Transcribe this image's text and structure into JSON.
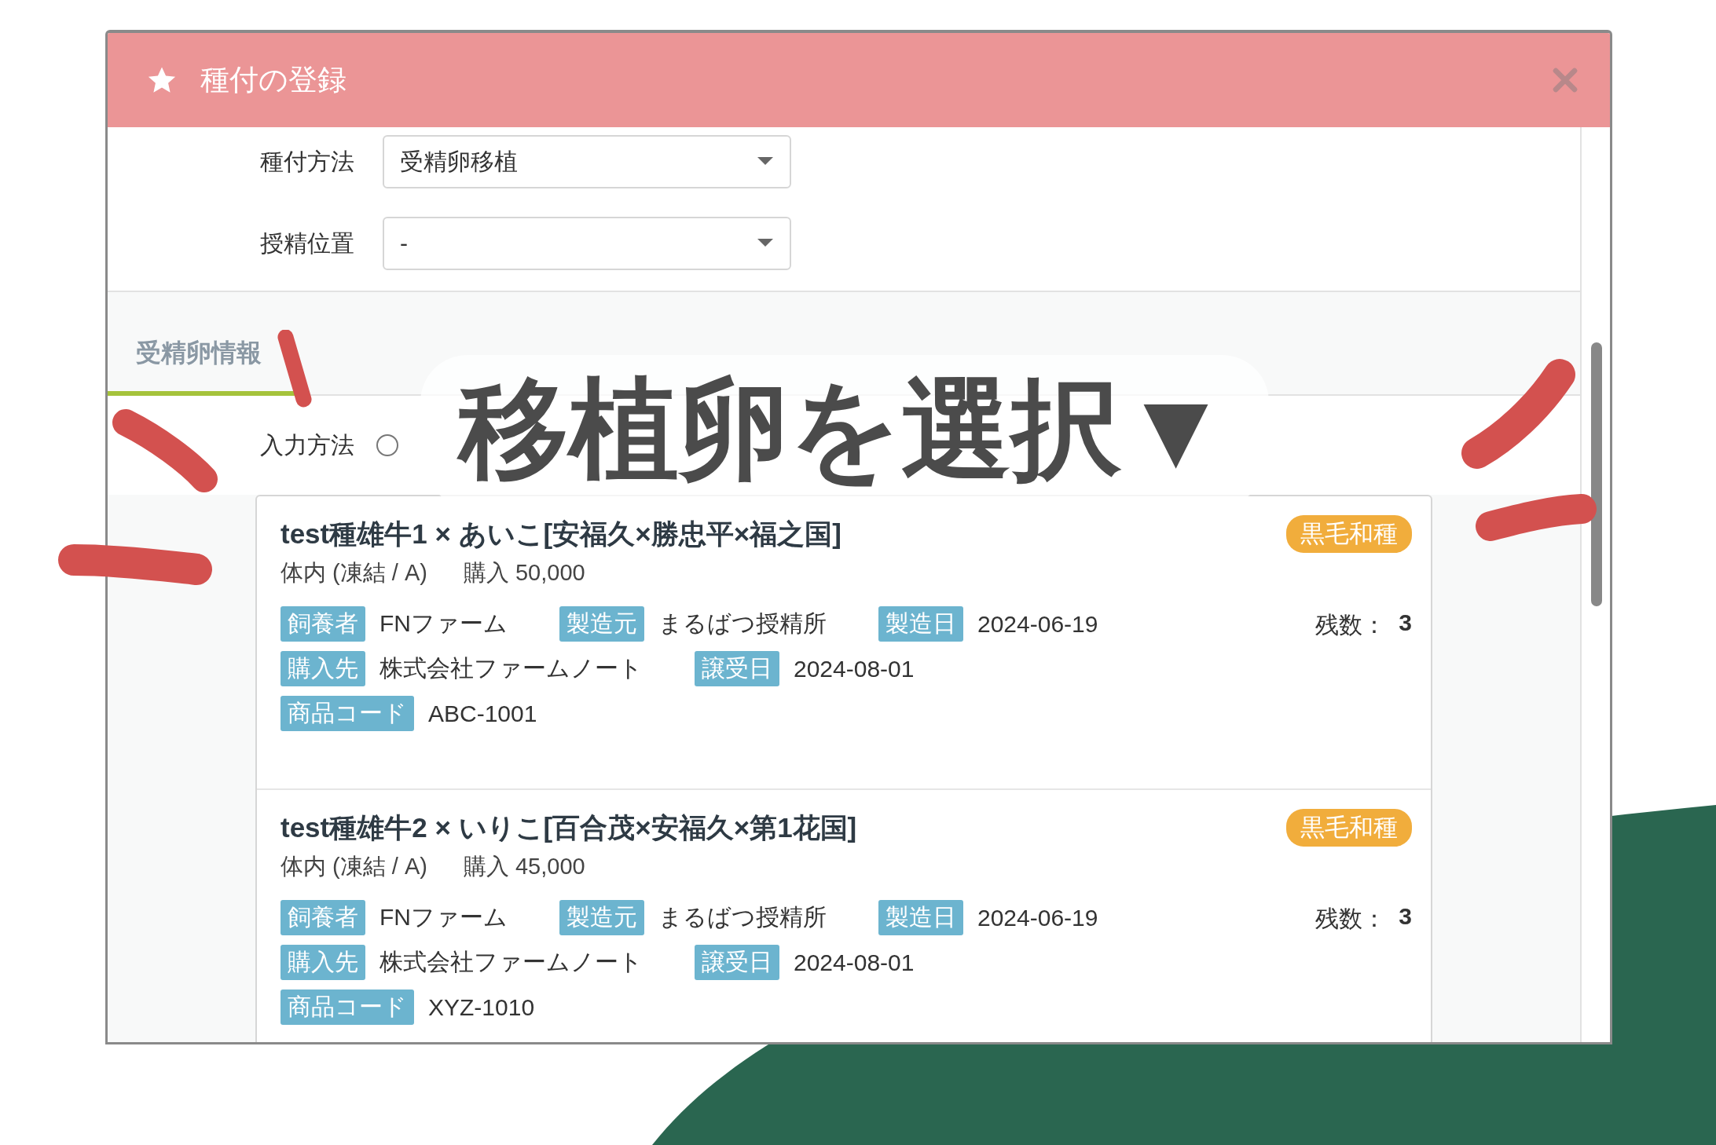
{
  "dialog": {
    "title": "種付の登録",
    "fields": [
      {
        "label": "種付方法",
        "value": "受精卵移植"
      },
      {
        "label": "授精位置",
        "value": "-"
      }
    ],
    "tabs": [
      {
        "label": "受精卵情報",
        "selected": true
      }
    ],
    "input_method": {
      "label": "入力方法",
      "radio": {
        "selected": false
      }
    },
    "cards": [
      {
        "title": "test種雄牛1 × あいこ[安福久×勝忠平×福之国]",
        "storage": "体内 (凍結 / A)",
        "price": "購入 50,000",
        "breed": "黒毛和種",
        "stock_label": "残数：",
        "stock": "3",
        "rows": [
          [
            {
              "tag": "飼養者",
              "value": "FNファーム"
            },
            {
              "tag": "製造元",
              "value": "まるばつ授精所"
            },
            {
              "tag": "製造日",
              "value": "2024-06-19"
            }
          ],
          [
            {
              "tag": "購入先",
              "value": "株式会社ファームノート"
            },
            {
              "tag": "譲受日",
              "value": "2024-08-01"
            }
          ],
          [
            {
              "tag": "商品コード",
              "value": "ABC-1001"
            }
          ]
        ]
      },
      {
        "title": "test種雄牛2 × いりこ[百合茂×安福久×第1花国]",
        "storage": "体内 (凍結 / A)",
        "price": "購入 45,000",
        "breed": "黒毛和種",
        "stock_label": "残数：",
        "stock": "3",
        "rows": [
          [
            {
              "tag": "飼養者",
              "value": "FNファーム"
            },
            {
              "tag": "製造元",
              "value": "まるばつ授精所"
            },
            {
              "tag": "製造日",
              "value": "2024-06-19"
            }
          ],
          [
            {
              "tag": "購入先",
              "value": "株式会社ファームノート"
            },
            {
              "tag": "譲受日",
              "value": "2024-08-01"
            }
          ],
          [
            {
              "tag": "商品コード",
              "value": "XYZ-1010"
            }
          ]
        ]
      }
    ]
  },
  "annotation": {
    "text": "移植卵を選択▼"
  }
}
